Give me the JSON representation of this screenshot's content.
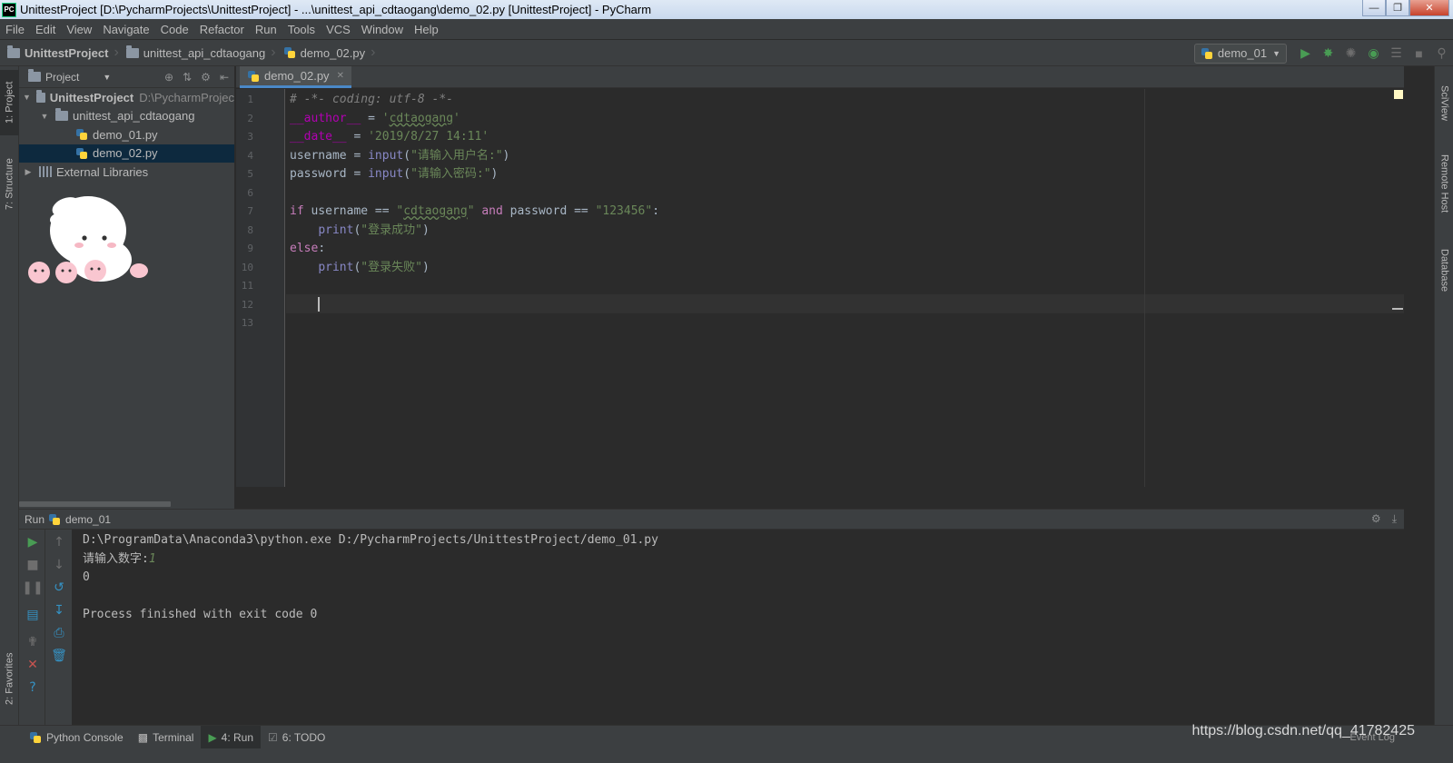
{
  "window": {
    "title": "UnittestProject [D:\\PycharmProjects\\UnittestProject] - ...\\unittest_api_cdtaogang\\demo_02.py [UnittestProject] - PyCharm",
    "app_icon": "PC"
  },
  "menu": [
    "File",
    "Edit",
    "View",
    "Navigate",
    "Code",
    "Refactor",
    "Run",
    "Tools",
    "VCS",
    "Window",
    "Help"
  ],
  "breadcrumb": [
    "UnittestProject",
    "unittest_api_cdtaogang",
    "demo_02.py"
  ],
  "run_config": "demo_01",
  "project_panel": {
    "title": "Project",
    "tree": [
      {
        "label": "UnittestProject",
        "path": "D:\\PycharmProjec",
        "expanded": true
      },
      {
        "label": "unittest_api_cdtaogang",
        "expanded": true
      },
      {
        "label": "demo_01.py"
      },
      {
        "label": "demo_02.py",
        "selected": true
      },
      {
        "label": "External Libraries",
        "expanded": false
      }
    ]
  },
  "left_tabs": [
    "1: Project",
    "7: Structure",
    "2: Favorites"
  ],
  "right_tabs": [
    "SciView",
    "Remote Host",
    "Database"
  ],
  "editor": {
    "tab": "demo_02.py",
    "line_numbers": [
      "1",
      "2",
      "3",
      "4",
      "5",
      "6",
      "7",
      "8",
      "9",
      "10",
      "11",
      "12",
      "13"
    ],
    "code": {
      "l1": "# -*- coding: utf-8 -*-",
      "l2_var": "__author__",
      "l2_eq": " = ",
      "l2_str_a": "'",
      "l2_str_b": "cdtaogang",
      "l2_str_c": "'",
      "l3_var": "__date__",
      "l3_eq": " = ",
      "l3_str": "'2019/8/27 14:11'",
      "l4_a": "username = ",
      "l4_fn": "input",
      "l4_b": "(",
      "l4_str": "\"请输入用户名:\"",
      "l4_c": ")",
      "l5_a": "password = ",
      "l5_fn": "input",
      "l5_b": "(",
      "l5_str": "\"请输入密码:\"",
      "l5_c": ")",
      "l7_kw": "if",
      "l7_a": " username == ",
      "l7_str_a": "\"",
      "l7_str_b": "cdtaogang",
      "l7_str_c": "\"",
      "l7_sp": " ",
      "l7_and": "and",
      "l7_b": " password == ",
      "l7_str2": "\"123456\"",
      "l7_c": ":",
      "l8_indent": "    ",
      "l8_fn": "print",
      "l8_b": "(",
      "l8_str": "\"登录成功\"",
      "l8_c": ")",
      "l9_kw": "else",
      "l9_c": ":",
      "l10_indent": "    ",
      "l10_fn": "print",
      "l10_b": "(",
      "l10_str": "\"登录失败\"",
      "l10_c": ")"
    }
  },
  "run_panel": {
    "label": "Run",
    "config": "demo_01",
    "output": {
      "cmd": "D:\\ProgramData\\Anaconda3\\python.exe D:/PycharmProjects/UnittestProject/demo_01.py",
      "prompt": "请输入数字:",
      "input": "1",
      "result": "0",
      "finished": "Process finished with exit code 0"
    }
  },
  "bottom_tabs": [
    "Python Console",
    "Terminal",
    "4: Run",
    "6: TODO"
  ],
  "watermark": "https://blog.csdn.net/qq_41782425",
  "event_log": "Event Log",
  "colors": {
    "accent": "#4a88c7",
    "run_green": "#499c54",
    "string": "#6a8759",
    "keyword": "#cc7832"
  }
}
